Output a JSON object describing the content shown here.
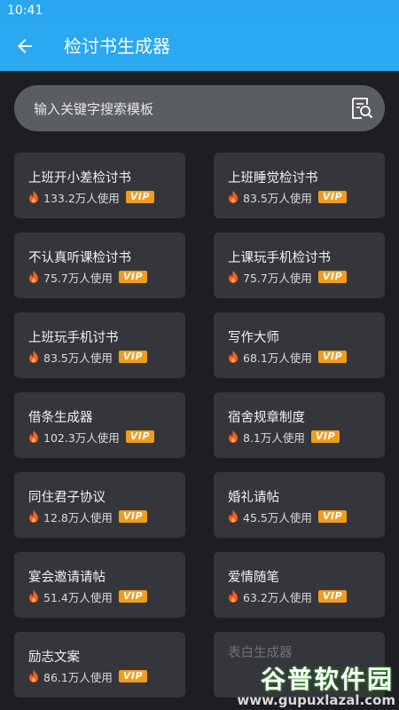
{
  "status_bar": {
    "time": "10:41"
  },
  "app_bar": {
    "title": "检讨书生成器",
    "back_icon": "arrow-left-icon"
  },
  "search": {
    "placeholder": "输入关键字搜索模板",
    "icon": "search-document-icon"
  },
  "colors": {
    "status_bar": "#29a6ee",
    "app_bar": "#2aa8f0",
    "background": "#1d1e22",
    "card": "#34363b",
    "vip_badge": "#f29c1e",
    "fire_icon": "#ff5a1f"
  },
  "templates": [
    {
      "name": "上班开小差检讨书",
      "uses": "133.2万人使用",
      "badge": "VIP"
    },
    {
      "name": "上班睡觉检讨书",
      "uses": "83.5万人使用",
      "badge": "VIP"
    },
    {
      "name": "不认真听课检讨书",
      "uses": "75.7万人使用",
      "badge": "VIP"
    },
    {
      "name": "上课玩手机检讨书",
      "uses": "75.7万人使用",
      "badge": "VIP"
    },
    {
      "name": "上班玩手机讨书",
      "uses": "83.5万人使用",
      "badge": "VIP"
    },
    {
      "name": "写作大师",
      "uses": "68.1万人使用",
      "badge": "VIP"
    },
    {
      "name": "借条生成器",
      "uses": "102.3万人使用",
      "badge": "VIP"
    },
    {
      "name": "宿舍规章制度",
      "uses": "8.1万人使用",
      "badge": "VIP"
    },
    {
      "name": "同住君子协议",
      "uses": "12.8万人使用",
      "badge": "VIP"
    },
    {
      "name": "婚礼请帖",
      "uses": "45.5万人使用",
      "badge": "VIP"
    },
    {
      "name": "宴会邀请请帖",
      "uses": "51.4万人使用",
      "badge": "VIP"
    },
    {
      "name": "爱情随笔",
      "uses": "63.2万人使用",
      "badge": "VIP"
    },
    {
      "name": "励志文案",
      "uses": "86.1万人使用",
      "badge": "VIP"
    },
    {
      "name": "表白生成器",
      "partial": true
    }
  ],
  "watermark": {
    "name": "谷普软件园",
    "url": "www.gupuxlazal.com"
  }
}
